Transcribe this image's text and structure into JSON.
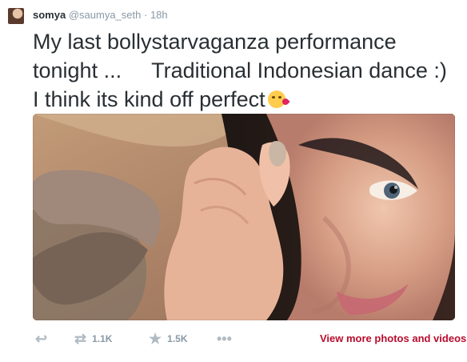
{
  "tweet": {
    "avatar_icon": "profile-picture",
    "author_name": "somya",
    "author_handle": "@saumya_seth",
    "separator": "·",
    "time_ago": "18h",
    "text": "My last bollystarvaganza performance tonight ...     Traditional Indonesian dance :) I think its kind off perfect",
    "emoji": "kissing-face-with-heart-emoji",
    "media": {
      "type": "photo",
      "description_icon": "selfie-photo"
    }
  },
  "actions": {
    "reply_icon": "reply-arrow-icon",
    "retweet_icon": "retweet-icon",
    "retweet_count": "1.1K",
    "favorite_icon": "star-icon",
    "favorite_count": "1.5K",
    "more_icon": "more-dots-icon",
    "view_more_label": "View more photos and videos"
  },
  "colors": {
    "text": "#292f33",
    "muted": "#8899a6",
    "link": "#b90c2d"
  }
}
